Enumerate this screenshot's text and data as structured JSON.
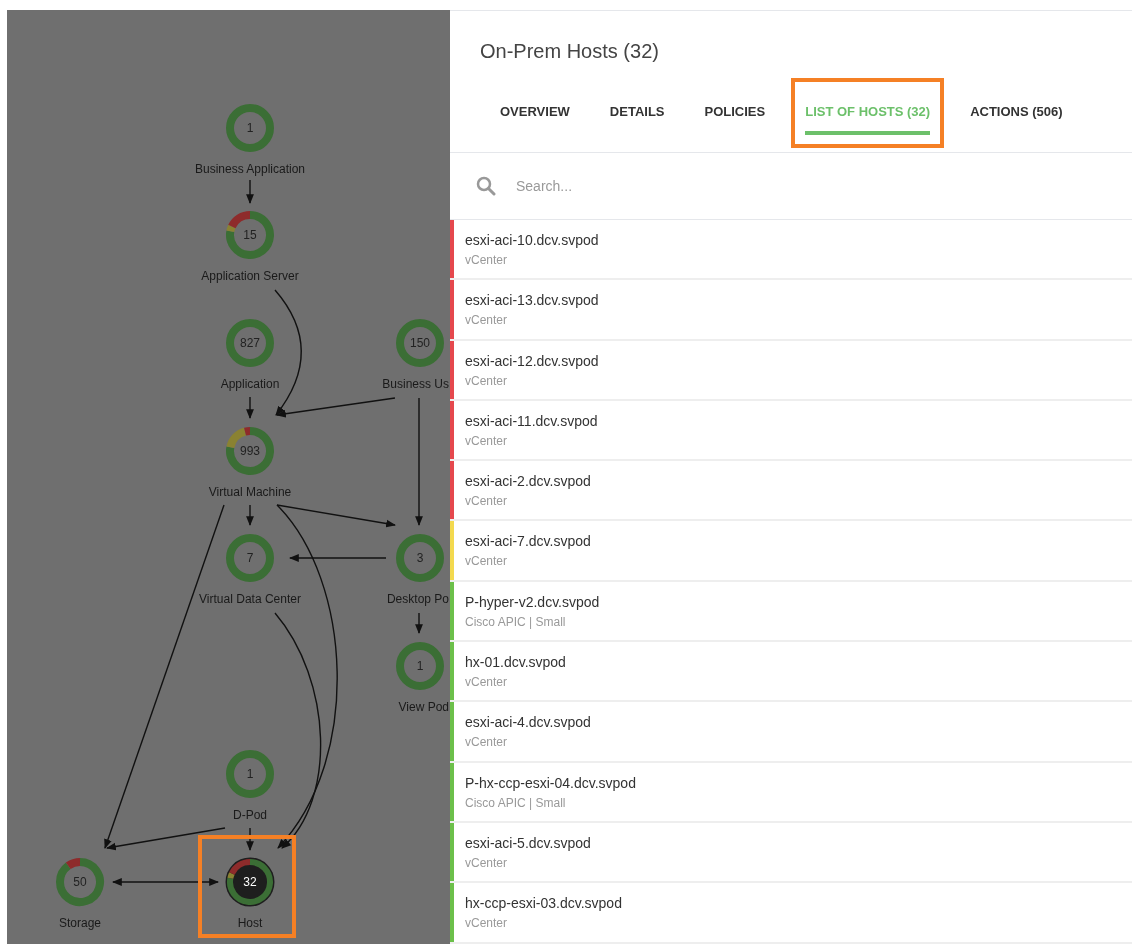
{
  "topology": {
    "nodes": [
      {
        "label": "Business Application",
        "count": "1",
        "selected": false,
        "highlighted": false,
        "segments": [
          {
            "color": "#3b6e35",
            "kind": "rest"
          }
        ]
      },
      {
        "label": "Application Server",
        "count": "15",
        "selected": false,
        "highlighted": false,
        "segments": [
          {
            "color": "#3b6e35",
            "kind": "rest"
          },
          {
            "color": "#8a8232",
            "kind": "sliver"
          },
          {
            "color": "#8e2b2b",
            "kind": "part"
          }
        ]
      },
      {
        "label": "Application",
        "count": "827",
        "selected": false,
        "highlighted": false,
        "segments": [
          {
            "color": "#3b6e35",
            "kind": "rest"
          }
        ]
      },
      {
        "label": "Business Us",
        "count": "150",
        "selected": false,
        "highlighted": false,
        "segments": [
          {
            "color": "#3b6e35",
            "kind": "rest"
          }
        ]
      },
      {
        "label": "Virtual Machine",
        "count": "993",
        "selected": false,
        "highlighted": false,
        "segments": [
          {
            "color": "#3b6e35",
            "kind": "rest"
          },
          {
            "color": "#8a8232",
            "kind": "part"
          },
          {
            "color": "#8e2b2b",
            "kind": "sliver"
          }
        ]
      },
      {
        "label": "Virtual Data Center",
        "count": "7",
        "selected": false,
        "highlighted": false,
        "segments": [
          {
            "color": "#3b6e35",
            "kind": "rest"
          }
        ]
      },
      {
        "label": "Desktop Po",
        "count": "3",
        "selected": false,
        "highlighted": false,
        "segments": [
          {
            "color": "#3b6e35",
            "kind": "rest"
          }
        ]
      },
      {
        "label": "View Pod",
        "count": "1",
        "selected": false,
        "highlighted": false,
        "segments": [
          {
            "color": "#3b6e35",
            "kind": "rest"
          }
        ]
      },
      {
        "label": "D-Pod",
        "count": "1",
        "selected": false,
        "highlighted": false,
        "segments": [
          {
            "color": "#3b6e35",
            "kind": "rest"
          }
        ]
      },
      {
        "label": "Storage",
        "count": "50",
        "selected": false,
        "highlighted": false,
        "segments": [
          {
            "color": "#3b6e35",
            "kind": "rest"
          },
          {
            "color": "#8e2b2b",
            "kind": "small"
          }
        ]
      },
      {
        "label": "Host",
        "count": "32",
        "selected": true,
        "highlighted": true,
        "segments": [
          {
            "color": "#3b6e35",
            "kind": "rest"
          },
          {
            "color": "#8a8232",
            "kind": "sliver"
          },
          {
            "color": "#8e2b2b",
            "kind": "part"
          }
        ]
      }
    ]
  },
  "panel": {
    "title": "On-Prem Hosts (32)",
    "tabs": [
      {
        "label": "OVERVIEW",
        "selected": false,
        "highlighted": false
      },
      {
        "label": "DETAILS",
        "selected": false,
        "highlighted": false
      },
      {
        "label": "POLICIES",
        "selected": false,
        "highlighted": false
      },
      {
        "label": "LIST OF HOSTS (32)",
        "selected": true,
        "highlighted": true
      },
      {
        "label": "ACTIONS (506)",
        "selected": false,
        "highlighted": false
      }
    ],
    "search": {
      "placeholder": "Search..."
    },
    "hosts": [
      {
        "name": "esxi-aci-10.dcv.svpod",
        "source": "vCenter",
        "color": "#e5484d"
      },
      {
        "name": "esxi-aci-13.dcv.svpod",
        "source": "vCenter",
        "color": "#e5484d"
      },
      {
        "name": "esxi-aci-12.dcv.svpod",
        "source": "vCenter",
        "color": "#e5484d"
      },
      {
        "name": "esxi-aci-11.dcv.svpod",
        "source": "vCenter",
        "color": "#e5484d"
      },
      {
        "name": "esxi-aci-2.dcv.svpod",
        "source": "vCenter",
        "color": "#e5484d"
      },
      {
        "name": "esxi-aci-7.dcv.svpod",
        "source": "vCenter",
        "color": "#f3d94e"
      },
      {
        "name": "P-hyper-v2.dcv.svpod",
        "source": "Cisco APIC | Small",
        "color": "#6cc04a"
      },
      {
        "name": "hx-01.dcv.svpod",
        "source": "vCenter",
        "color": "#6cc04a"
      },
      {
        "name": "esxi-aci-4.dcv.svpod",
        "source": "vCenter",
        "color": "#6cc04a"
      },
      {
        "name": "P-hx-ccp-esxi-04.dcv.svpod",
        "source": "Cisco APIC | Small",
        "color": "#6cc04a"
      },
      {
        "name": "esxi-aci-5.dcv.svpod",
        "source": "vCenter",
        "color": "#6cc04a"
      },
      {
        "name": "hx-ccp-esxi-03.dcv.svpod",
        "source": "vCenter",
        "color": "#6cc04a"
      }
    ]
  }
}
